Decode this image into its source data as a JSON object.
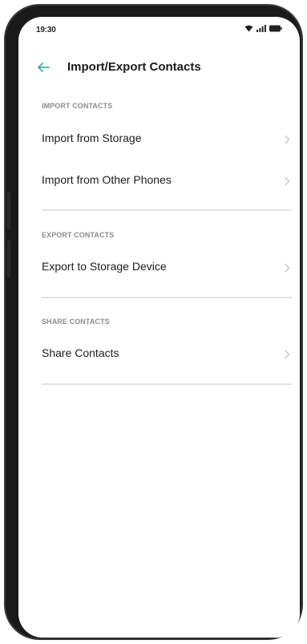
{
  "status_bar": {
    "time": "19:30",
    "icons": [
      "wifi-icon",
      "signal-icon",
      "battery-icon"
    ]
  },
  "header": {
    "back_icon": "back-arrow-icon",
    "title": "Import/Export Contacts"
  },
  "sections": [
    {
      "label": "IMPORT CONTACTS",
      "items": [
        "Import from Storage",
        "Import from Other Phones"
      ]
    },
    {
      "label": "EXPORT CONTACTS",
      "items": [
        "Export to Storage Device"
      ]
    },
    {
      "label": "SHARE CONTACTS",
      "items": [
        "Share Contacts"
      ]
    }
  ],
  "colors": {
    "accent": "#3db39e",
    "label_gray": "#8c8c8c",
    "chevron_gray": "#c4c4c4",
    "divider": "#e3e3e3"
  }
}
